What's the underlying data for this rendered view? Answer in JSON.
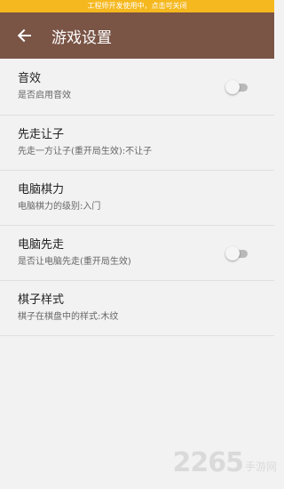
{
  "banner": {
    "text": "工程师开发使用中，点击可关闭"
  },
  "appbar": {
    "title": "游戏设置",
    "back_icon": "arrow-left-icon"
  },
  "settings": [
    {
      "title": "音效",
      "subtitle": "是否启用音效",
      "has_switch": true,
      "switch_on": false
    },
    {
      "title": "先走让子",
      "subtitle": "先走一方让子(重开局生效):不让子",
      "has_switch": false
    },
    {
      "title": "电脑棋力",
      "subtitle": "电脑棋力的级别:入门",
      "has_switch": false
    },
    {
      "title": "电脑先走",
      "subtitle": "是否让电脑先走(重开局生效)",
      "has_switch": true,
      "switch_on": false
    },
    {
      "title": "棋子样式",
      "subtitle": "棋子在棋盘中的样式:木纹",
      "has_switch": false
    }
  ],
  "watermark": {
    "digits": "2265",
    "text": "手游网"
  },
  "colors": {
    "banner": "#f5b81e",
    "appbar": "#7a5546",
    "background": "#f2f2f2"
  }
}
